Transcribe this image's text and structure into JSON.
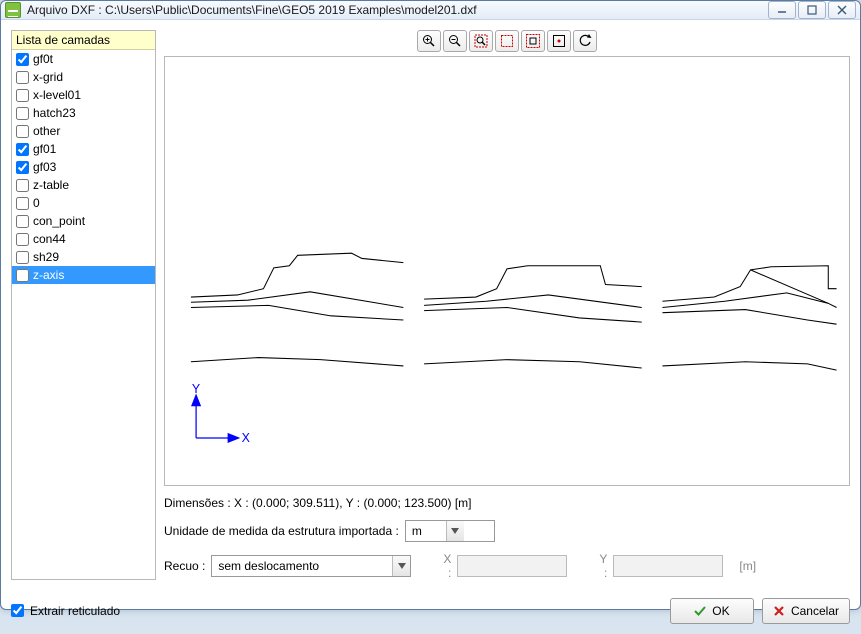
{
  "window": {
    "title": "Arquivo DXF : C:\\Users\\Public\\Documents\\Fine\\GEO5 2019 Examples\\model201.dxf"
  },
  "layers": {
    "header": "Lista de camadas",
    "items": [
      {
        "name": "gf0t",
        "checked": true,
        "selected": false
      },
      {
        "name": "x-grid",
        "checked": false,
        "selected": false
      },
      {
        "name": "x-level01",
        "checked": false,
        "selected": false
      },
      {
        "name": "hatch23",
        "checked": false,
        "selected": false
      },
      {
        "name": "other",
        "checked": false,
        "selected": false
      },
      {
        "name": "gf01",
        "checked": true,
        "selected": false
      },
      {
        "name": "gf03",
        "checked": true,
        "selected": false
      },
      {
        "name": "z-table",
        "checked": false,
        "selected": false
      },
      {
        "name": "0",
        "checked": false,
        "selected": false
      },
      {
        "name": "con_point",
        "checked": false,
        "selected": false
      },
      {
        "name": "con44",
        "checked": false,
        "selected": false
      },
      {
        "name": "sh29",
        "checked": false,
        "selected": false
      },
      {
        "name": "z-axis",
        "checked": false,
        "selected": true
      }
    ]
  },
  "toolbar": {
    "tools": [
      "zoom-in-icon",
      "zoom-out-icon",
      "zoom-selection-icon",
      "zoom-window-icon",
      "zoom-extents-icon",
      "zoom-center-icon",
      "refresh-icon"
    ]
  },
  "canvas": {
    "axis_x": "X",
    "axis_y": "Y"
  },
  "dimensions_text": "Dimensões : X : (0.000; 309.511), Y : (0.000; 123.500) [m]",
  "unit_row": {
    "label": "Unidade de medida da estrutura importada :",
    "value": "m"
  },
  "recuo_row": {
    "label": "Recuo :",
    "value": "sem deslocamento",
    "x_label": "X :",
    "x_value": "",
    "y_label": "Y :",
    "y_value": "",
    "unit": "[m]"
  },
  "footer": {
    "extract_label": "Extrair reticulado",
    "extract_checked": true,
    "ok": "OK",
    "cancel": "Cancelar"
  },
  "colors": {
    "axis": "#0000ff",
    "ok_icon": "#2e9a2e",
    "cancel_icon": "#cc1f1f"
  }
}
